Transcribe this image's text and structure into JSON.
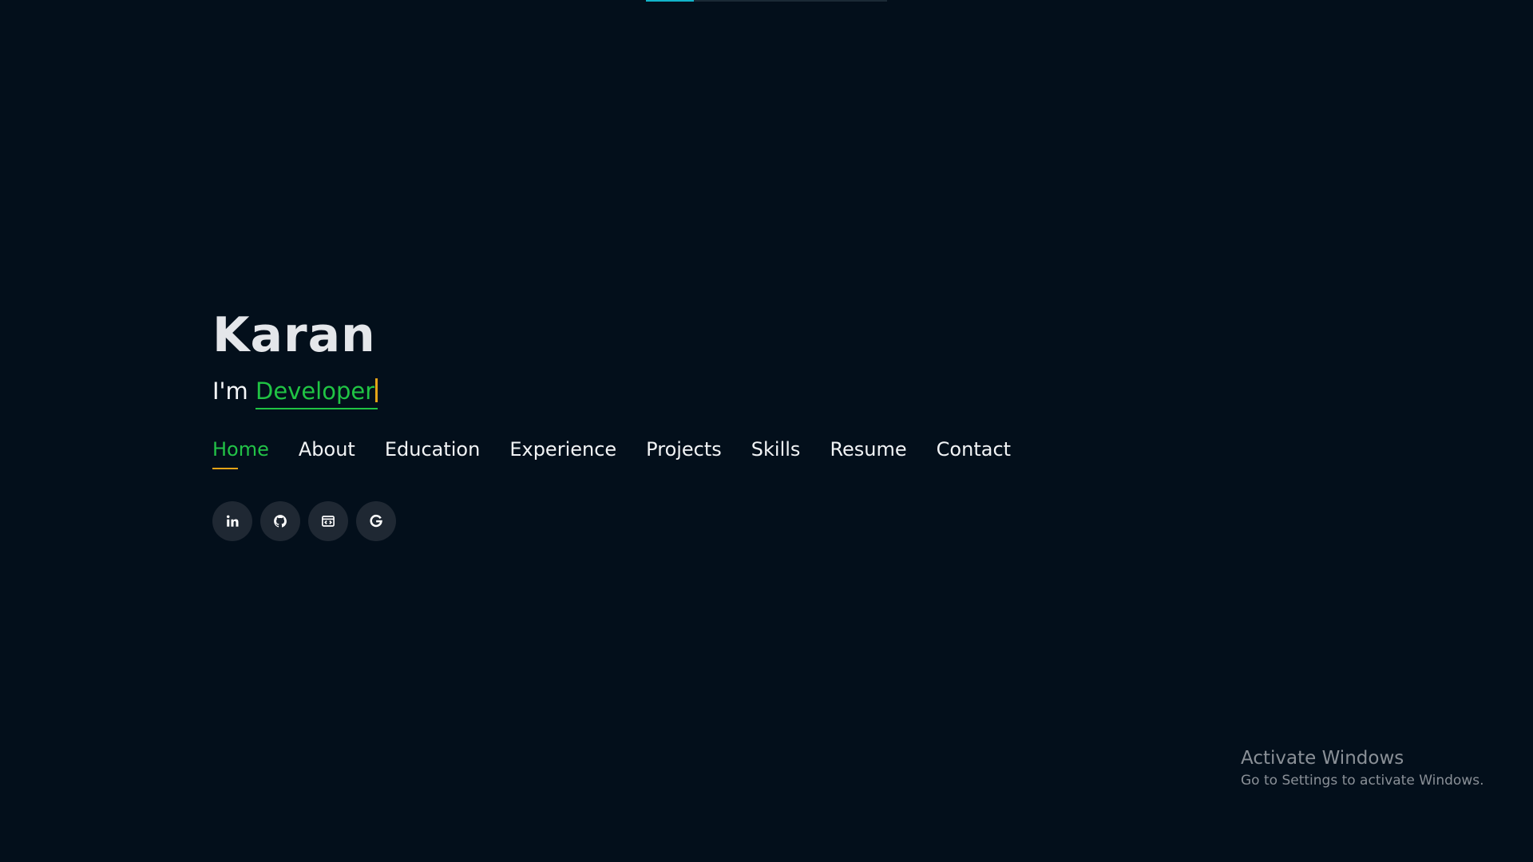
{
  "progress": {
    "fraction": 0.2,
    "color": "#12b3c9"
  },
  "hero": {
    "name": "Karan",
    "prefix": "I'm ",
    "role": "Developer"
  },
  "nav": {
    "items": [
      {
        "label": "Home",
        "active": true
      },
      {
        "label": "About",
        "active": false
      },
      {
        "label": "Education",
        "active": false
      },
      {
        "label": "Experience",
        "active": false
      },
      {
        "label": "Projects",
        "active": false
      },
      {
        "label": "Skills",
        "active": false
      },
      {
        "label": "Resume",
        "active": false
      },
      {
        "label": "Contact",
        "active": false
      }
    ]
  },
  "socials": [
    {
      "icon": "linkedin-icon"
    },
    {
      "icon": "github-icon"
    },
    {
      "icon": "code-window-icon"
    },
    {
      "icon": "google-icon"
    }
  ],
  "watermark": {
    "title": "Activate Windows",
    "subtitle": "Go to Settings to activate Windows."
  },
  "colors": {
    "background": "#030f1b",
    "accent_green": "#22c247",
    "accent_orange": "#e4a417",
    "text": "#f2f4f6"
  }
}
